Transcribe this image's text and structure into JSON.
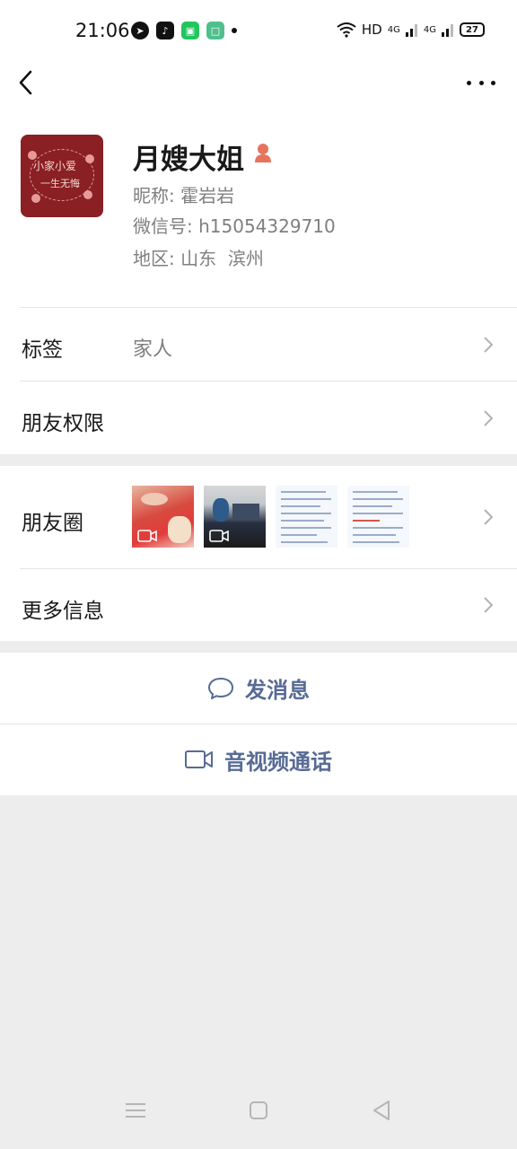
{
  "status_bar": {
    "time": "21:06",
    "network_label": "HD",
    "signal1": "4G",
    "signal2": "4G",
    "battery": "27"
  },
  "profile": {
    "display_name": "月嫂大姐",
    "nickname_key": "昵称:",
    "nickname_value": "霍岩岩",
    "wechat_id_key": "微信号:",
    "wechat_id_value": "h15054329710",
    "region_key": "地区:",
    "region_value": "山东  滨州",
    "avatar_text_line1": "小家小爱",
    "avatar_text_line2": "一生无悔"
  },
  "rows": {
    "tags_label": "标签",
    "tags_value": "家人",
    "friend_permissions_label": "朋友权限",
    "moments_label": "朋友圈",
    "more_info_label": "更多信息"
  },
  "actions": {
    "send_message": "发消息",
    "video_call": "音视频通话"
  },
  "colors": {
    "link_blue": "#576b95",
    "background": "#ededed",
    "gender_icon": "#e6735c"
  }
}
